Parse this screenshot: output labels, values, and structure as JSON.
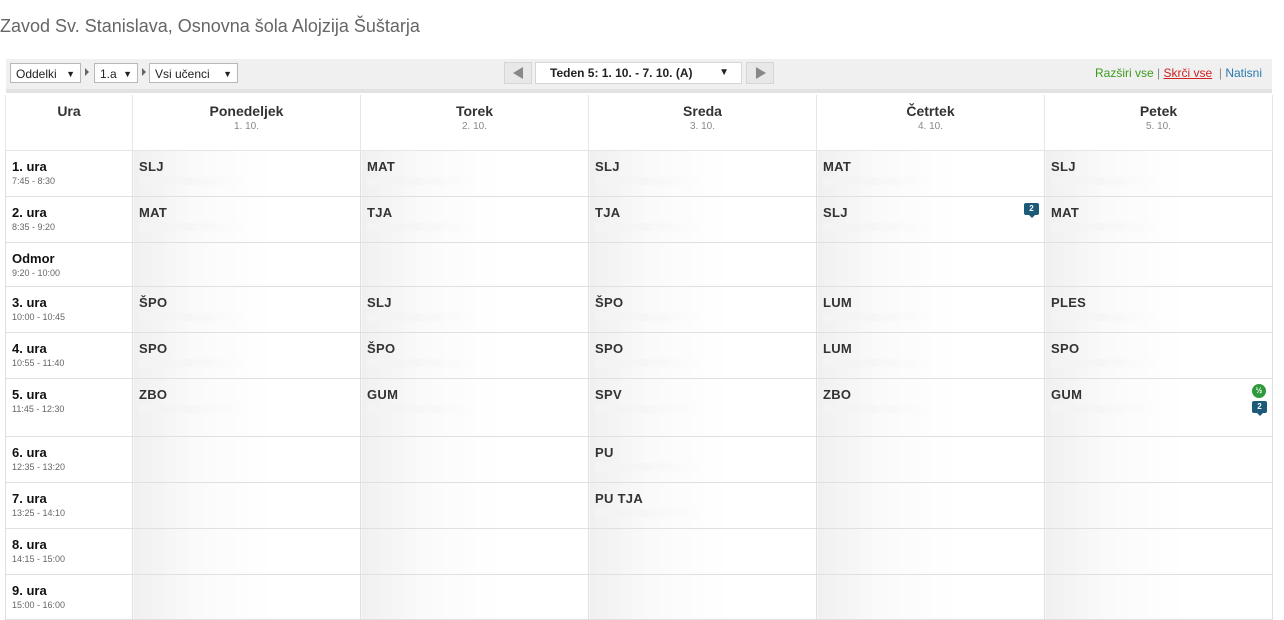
{
  "header": {
    "title": "Zavod Sv. Stanislava, Osnovna šola Alojzija Šuštarja"
  },
  "toolbar": {
    "filter1": "Oddelki",
    "filter2": "1.a",
    "filter3": "Vsi učenci",
    "week": "Teden 5: 1. 10. - 7. 10. (A)",
    "expand_all": "Razširi vse",
    "collapse_all": "Skrči vse",
    "print": "Natisni",
    "separator": "|"
  },
  "table": {
    "hour_header": "Ura",
    "days": [
      {
        "name": "Ponedeljek",
        "date": "1. 10."
      },
      {
        "name": "Torek",
        "date": "2. 10."
      },
      {
        "name": "Sreda",
        "date": "3. 10."
      },
      {
        "name": "Četrtek",
        "date": "4. 10."
      },
      {
        "name": "Petek",
        "date": "5. 10."
      }
    ],
    "rows": [
      {
        "name": "1. ura",
        "time": "7:45 - 8:30",
        "cells": [
          "SLJ",
          "MAT",
          "SLJ",
          "MAT",
          "SLJ"
        ]
      },
      {
        "name": "2. ura",
        "time": "8:35 - 9:20",
        "cells": [
          "MAT",
          "TJA",
          "TJA",
          "SLJ",
          "MAT"
        ],
        "badge": "2"
      },
      {
        "name": "Odmor",
        "time": "9:20 - 10:00",
        "cells": [
          "",
          "",
          "",
          "",
          ""
        ]
      },
      {
        "name": "3. ura",
        "time": "10:00 - 10:45",
        "cells": [
          "ŠPO",
          "SLJ",
          "ŠPO",
          "LUM",
          "PLES"
        ]
      },
      {
        "name": "4. ura",
        "time": "10:55 - 11:40",
        "cells": [
          "SPO",
          "ŠPO",
          "SPO",
          "LUM",
          "SPO"
        ]
      },
      {
        "name": "5. ura",
        "time": "11:45 - 12:30",
        "cells": [
          "ZBO",
          "GUM",
          "SPV",
          "ZBO",
          "GUM"
        ],
        "badge_green": "½",
        "badge2": "2"
      },
      {
        "name": "6. ura",
        "time": "12:35 - 13:20",
        "cells": [
          "",
          "",
          "PU",
          "",
          ""
        ]
      },
      {
        "name": "7. ura",
        "time": "13:25 - 14:10",
        "cells": [
          "",
          "",
          "PU TJA",
          "",
          ""
        ]
      },
      {
        "name": "8. ura",
        "time": "14:15 - 15:00",
        "cells": [
          "",
          "",
          "",
          "",
          ""
        ]
      },
      {
        "name": "9. ura",
        "time": "15:00 - 16:00",
        "cells": [
          "",
          "",
          "",
          "",
          ""
        ]
      }
    ]
  },
  "colors": {
    "expand": "#3c9a1e",
    "collapse": "#cc2222",
    "print": "#2a7ab0",
    "badge": "#1c5a7a",
    "badge_green": "#2e9a3c"
  },
  "icons": {
    "prev": "triangle-left-icon",
    "next": "triangle-right-icon",
    "dropdown": "caret-down-icon"
  }
}
